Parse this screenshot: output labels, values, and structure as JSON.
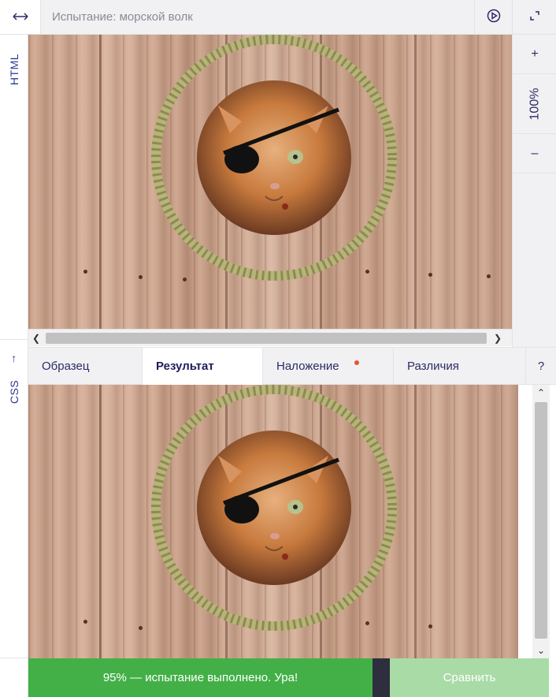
{
  "header": {
    "title": "Испытание: морской волк",
    "expand_icon": "horizontal-arrows-icon",
    "play_icon": "play-circle-icon",
    "fullscreen_icon": "fullscreen-icon"
  },
  "sidebar": {
    "html_label": "HTML",
    "css_arrow": "↑",
    "css_label": "CSS"
  },
  "zoom": {
    "plus": "+",
    "level": "100%",
    "minus": "–"
  },
  "tabs": [
    {
      "label": "Образец",
      "active": false
    },
    {
      "label": "Результат",
      "active": true
    },
    {
      "label": "Наложение",
      "active": false,
      "indicator_color": "#e4572e"
    },
    {
      "label": "Различия",
      "active": false
    },
    {
      "label": "?",
      "active": false
    }
  ],
  "footer": {
    "status": "95% — испытание выполнено. Ура!",
    "compare_label": "Сравнить"
  },
  "colors": {
    "status_green": "#43b047",
    "compare_green": "#a9dba7",
    "accent_navy": "#2b2b66",
    "rope": "#b7b47a"
  }
}
